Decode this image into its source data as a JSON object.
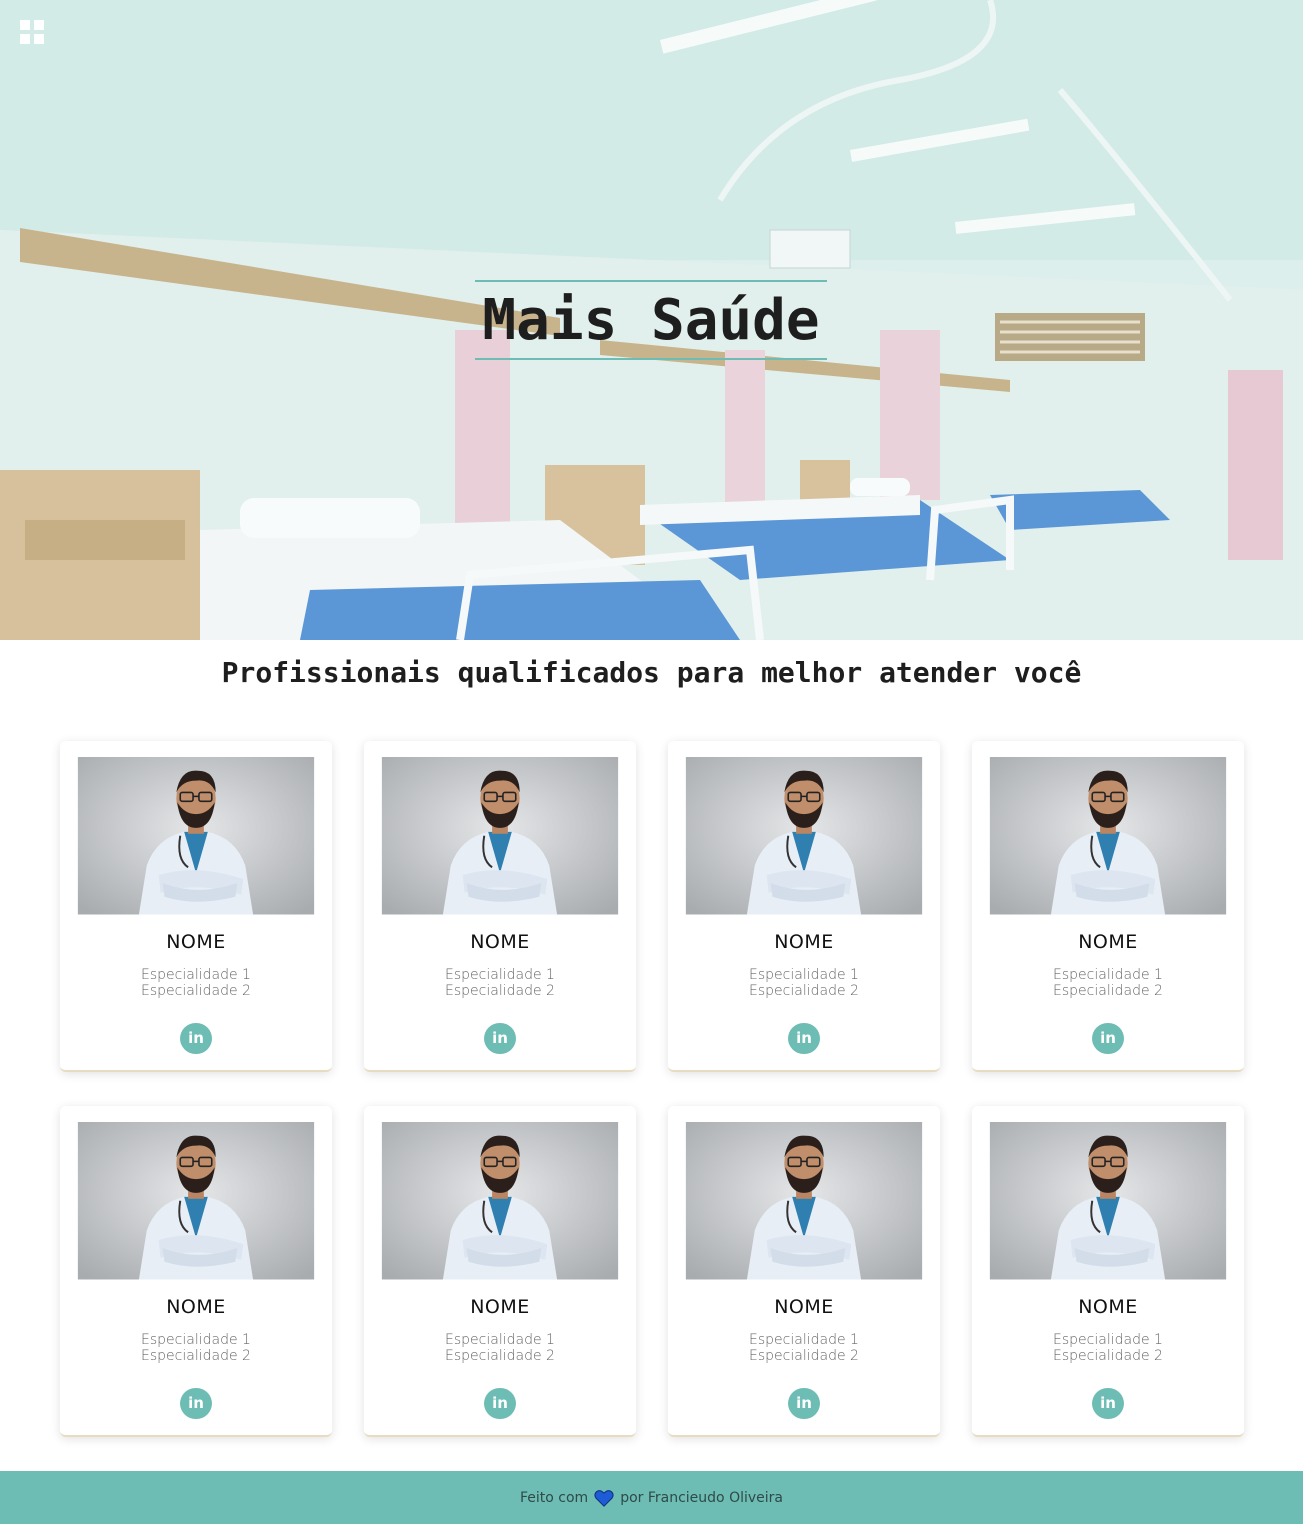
{
  "hero": {
    "title": "Mais Saúde",
    "menu_icon": "grid-menu-icon"
  },
  "section": {
    "title": "Profissionais qualificados para melhor atender você"
  },
  "cards": [
    {
      "name": "NOME",
      "specialty_1": "Especialidade 1",
      "specialty_2": "Especialidade 2",
      "social": "in"
    },
    {
      "name": "NOME",
      "specialty_1": "Especialidade 1",
      "specialty_2": "Especialidade 2",
      "social": "in"
    },
    {
      "name": "NOME",
      "specialty_1": "Especialidade 1",
      "specialty_2": "Especialidade 2",
      "social": "in"
    },
    {
      "name": "NOME",
      "specialty_1": "Especialidade 1",
      "specialty_2": "Especialidade 2",
      "social": "in"
    },
    {
      "name": "NOME",
      "specialty_1": "Especialidade 1",
      "specialty_2": "Especialidade 2",
      "social": "in"
    },
    {
      "name": "NOME",
      "specialty_1": "Especialidade 1",
      "specialty_2": "Especialidade 2",
      "social": "in"
    },
    {
      "name": "NOME",
      "specialty_1": "Especialidade 1",
      "specialty_2": "Especialidade 2",
      "social": "in"
    },
    {
      "name": "NOME",
      "specialty_1": "Especialidade 1",
      "specialty_2": "Especialidade 2",
      "social": "in"
    }
  ],
  "footer": {
    "prefix": "Feito com",
    "suffix": "por Francieudo Oliveira",
    "heart_icon": "heart-icon"
  },
  "colors": {
    "accent": "#6dbdb5",
    "heart": "#1e5bd6"
  }
}
